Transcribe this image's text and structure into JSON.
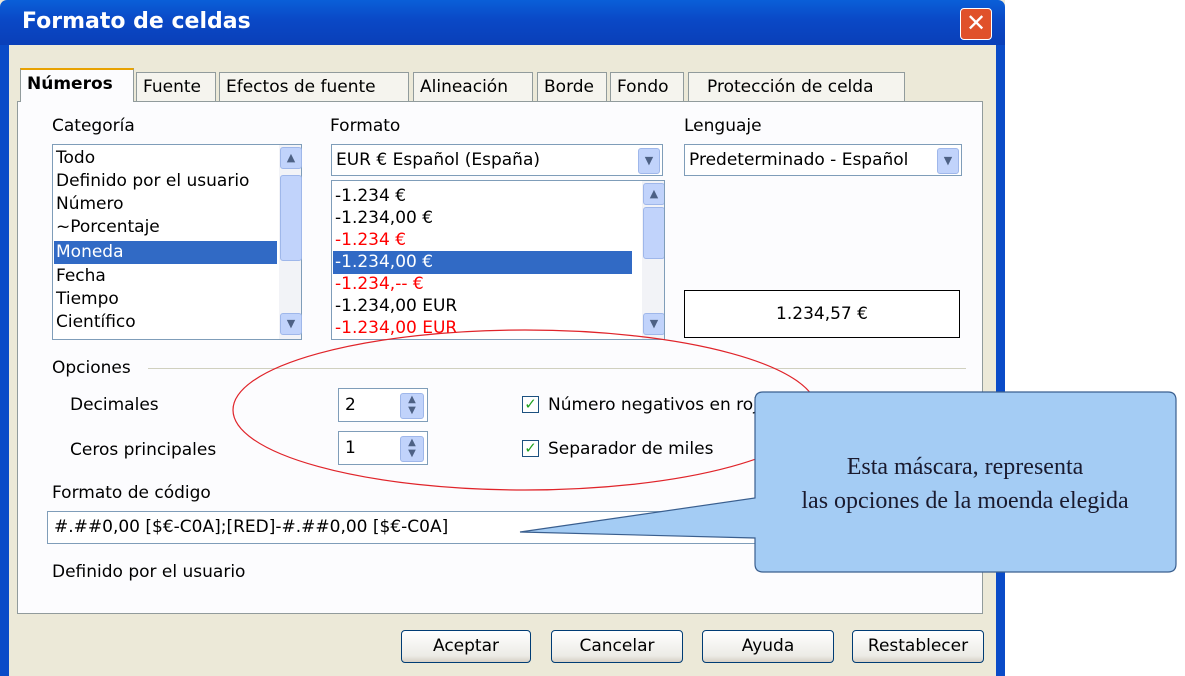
{
  "window": {
    "title": "Formato de celdas",
    "close_glyph": "✕"
  },
  "tabs": [
    "Números",
    "Fuente",
    "Efectos de fuente",
    "Alineación",
    "Borde",
    "Fondo",
    "Protección de celda"
  ],
  "category": {
    "label": "Categoría",
    "items": [
      "Todo",
      "Definido por el usuario",
      "Número",
      "~Porcentaje",
      "Moneda",
      "Fecha",
      "Tiempo",
      "Científico"
    ],
    "selected": "Moneda"
  },
  "format": {
    "label": "Formato",
    "currency_combo": "EUR  €  Español (España)",
    "items": [
      {
        "text": "-1.234 €",
        "red": false,
        "selected": false
      },
      {
        "text": "-1.234,00 €",
        "red": false,
        "selected": false
      },
      {
        "text": "-1.234 €",
        "red": true,
        "selected": false
      },
      {
        "text": "-1.234,00 €",
        "red": true,
        "selected": true
      },
      {
        "text": "-1.234,-- €",
        "red": true,
        "selected": false
      },
      {
        "text": "-1.234,00 EUR",
        "red": false,
        "selected": false
      },
      {
        "text": "-1.234,00 EUR",
        "red": true,
        "selected": false
      }
    ]
  },
  "language": {
    "label": "Lenguaje",
    "value": "Predeterminado - Español"
  },
  "preview": {
    "value": "1.234,57 €"
  },
  "options": {
    "label": "Opciones",
    "decimals_label": "Decimales",
    "decimals_value": "2",
    "leading_zeros_label": "Ceros principales",
    "leading_zeros_value": "1",
    "negative_red_label": "Número negativos en roj",
    "negative_red_checked": true,
    "thousands_sep_label": "Separador de miles",
    "thousands_sep_checked": true
  },
  "format_code": {
    "label": "Formato de código",
    "value": "#.##0,00 [$€-C0A];[RED]-#.##0,00 [$€-C0A]",
    "description": "Definido por el usuario"
  },
  "buttons": {
    "ok": "Aceptar",
    "cancel": "Cancelar",
    "help": "Ayuda",
    "reset": "Restablecer"
  },
  "annotation": {
    "line1": "Esta máscara, representa",
    "line2": "las opciones de la moenda elegida",
    "fill_color": "#a4ccf4",
    "ellipse_color": "#e0242a"
  }
}
